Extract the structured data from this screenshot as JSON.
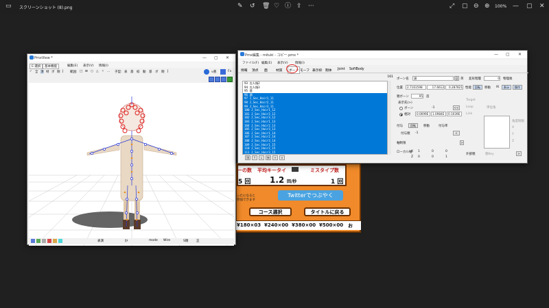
{
  "viewer": {
    "filename": "スクリーンショット (8).png",
    "zoom": "100%"
  },
  "pmxview": {
    "title": "PmxView *",
    "menu": [
      "E:選択",
      "基本機能",
      "編集(E)",
      "表示(V)",
      "情報(I)"
    ],
    "toolbar_left": [
      "全",
      "頂",
      "材",
      "ボ",
      "剛",
      "J",
      "範囲:",
      "□",
      "⊞",
      "○",
      "△",
      "✧",
      "十字",
      "表",
      "基",
      "絞",
      "動",
      "基",
      "ボ",
      "剛",
      "J"
    ],
    "labels": {
      "check": "✓",
      "toolbar_ellipsis": "...",
      "mode_prefix": "子型:",
      "vx": "v選",
      "fx": "Fx"
    },
    "status": {
      "left": [
        "表演",
        "ｶﾒ"
      ],
      "right": [
        "mode",
        "Wire",
        "S剛",
        "正"
      ]
    }
  },
  "pmx_editor": {
    "title": "Pmx編集 - mituki - コピー.pmx *",
    "menu": [
      "ファイル(F)",
      "編集(E)",
      "表示(V)",
      "情報(I)"
    ],
    "tabs": [
      "情報",
      "頂点",
      "面",
      "材質",
      "ボーン",
      "モーフ",
      "表示枠",
      "剛体",
      "Joint",
      "SoftBody"
    ],
    "active_tab": "ボーン",
    "list_count": "161",
    "bones_unselected": [
      "93 左人指2",
      "94 左人指3",
      "95 首"
    ],
    "bones_selected": [
      "96 頭",
      "97 J_Sec_Hair1_11",
      "98 J_Sec_Hair2_11",
      "99 J_Sec_Hair3_11",
      "100 J_Sec_Hair1_12",
      "101 J_Sec_Hair2_12",
      "102 J_Sec_Hair3_12",
      "103 J_Sec_Hair1_13",
      "104 J_Sec_Hair2_13",
      "105 J_Sec_Hair3_13",
      "106 J_Sec_Hair1_14",
      "107 J_Sec_Hair2_14",
      "108 J_Sec_Hair3_14",
      "109 J_Sec_Hair1_15",
      "110 J_Sec_Hair2_15",
      "111 J_Sec_Hair3_15",
      "112 J_Sec_Hair1_16",
      "113 J_Sec_Hair2_16",
      "114 J_Sec_Hair3_16"
    ],
    "list_footer": [
      "頂",
      "↑",
      "↓",
      "挟",
      "+",
      "×"
    ],
    "bone_name_label": "ボーン名",
    "bone_name": "頭",
    "bone_name_suffix": "日",
    "bone_name_en_label": "英",
    "deform_label": "変形階層",
    "deform_value": "0",
    "physics_label": "物理後",
    "position_label": "位置",
    "pos": [
      "2.7161598",
      "17.6612",
      "0.287821"
    ],
    "properties_label": "性能",
    "rotate_btn": "回転",
    "move_btn": "移動",
    "ik_label": "IK",
    "display_btn": "表示",
    "operate_btn": "操作",
    "parent_label": "親ボーン",
    "parent_value": "95",
    "parent_name": "首",
    "display_dest_label": "表示先(>)",
    "radio_bone": "ボーン",
    "radio_offset": "相対",
    "bone_dash": "-1",
    "offset": [
      "0.0699E",
      "1.0984E",
      "0.1039E"
    ],
    "grant_label": "付与",
    "grant_rot": "回転",
    "grant_move": "移動",
    "grant_rate_label": "付与率",
    "grant_parent_label": "付与親",
    "grant_dash": "-1",
    "axis_label": "軸制限",
    "local_label": "ローカル軸",
    "local_x": "X",
    "local_z": "Z",
    "local_vals": [
      "1",
      "0",
      "0",
      "0",
      "0",
      "1"
    ],
    "right_panel": {
      "target": "Target",
      "loop": "Loop",
      "unit_angle": "単位角",
      "link": "Link",
      "angle_limit": "角度制限",
      "dash": "-",
      "ik_x": "X",
      "ik_y": "Y",
      "ik_z": "Z",
      "ext_parent": "外部親",
      "key": "親Key"
    }
  },
  "game": {
    "hdr_left": "ーの数",
    "hdr_mid": "平均キータイ",
    "hdr_right": "ミスタイプ数",
    "val_left": "5 回",
    "val_mid": "1.2",
    "val_mid_unit": "回/秒",
    "val_right": "1 回",
    "twitter": "Twitterでつぶやく",
    "course": "コース選択",
    "back_title": "タイトルに戻る",
    "small_note": "ぃたになると\n参加できます",
    "prices": [
      "¥180×03",
      "¥240×00",
      "¥380×00",
      "¥500×00"
    ],
    "end_char": "お"
  },
  "colors": {
    "accent": "#0078d7",
    "game_orange": "#f08a2a",
    "twitter_blue": "#4aa3e0",
    "red_circle": "#e02020"
  }
}
